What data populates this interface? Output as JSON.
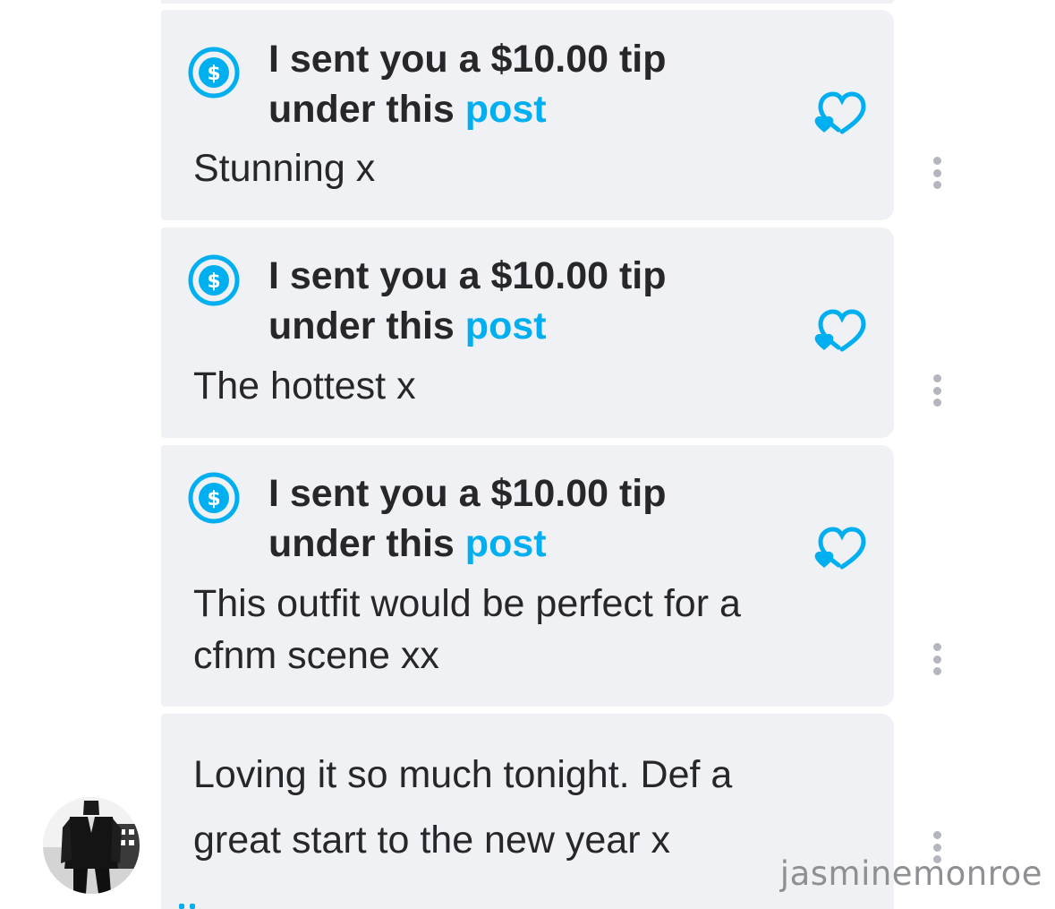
{
  "colors": {
    "accent": "#00aff0",
    "bubble_bg": "#f0f1f4",
    "text": "#26262b",
    "kebab": "#b3b6bd",
    "watermark": "#8f9094"
  },
  "messages": [
    {
      "tip_prefix": "I sent you a $10.00 tip",
      "tip_under": "under this ",
      "tip_link": "post",
      "lines": [
        "Stunning x"
      ],
      "icon": "dollar-circle-icon",
      "like_icon": "heart-tip-icon"
    },
    {
      "tip_prefix": "I sent you a $10.00 tip",
      "tip_under": "under this ",
      "tip_link": "post",
      "lines": [
        "The hottest x"
      ],
      "icon": "dollar-circle-icon",
      "like_icon": "heart-tip-icon"
    },
    {
      "tip_prefix": "I sent you a $10.00 tip",
      "tip_under": "under this ",
      "tip_link": "post",
      "lines": [
        "This outfit would be perfect for a",
        "cfnm scene xx"
      ],
      "icon": "dollar-circle-icon",
      "like_icon": "heart-tip-icon"
    },
    {
      "lines": [
        "Loving it so much tonight. Def a",
        "great start to the new year x"
      ]
    }
  ],
  "watermark": "jasminemonroe"
}
